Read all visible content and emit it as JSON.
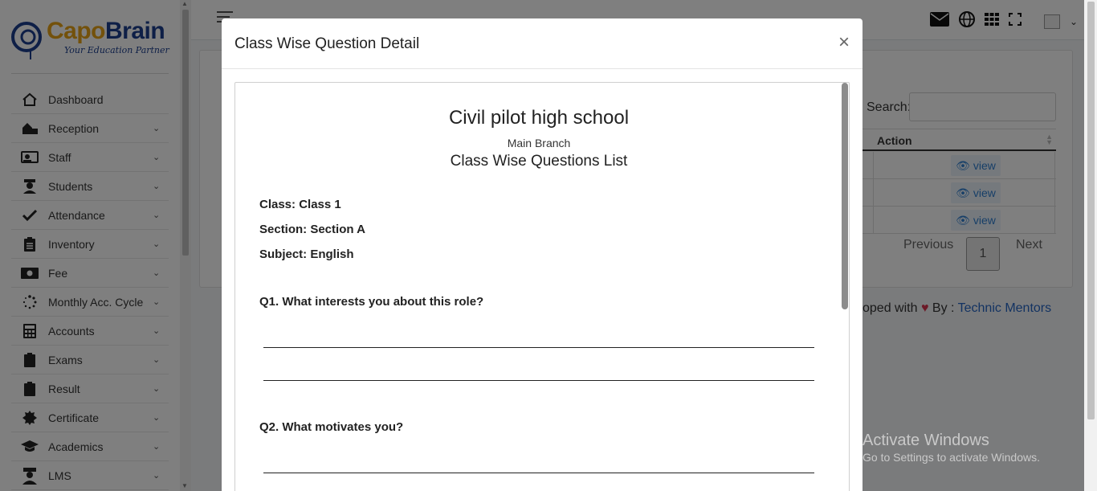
{
  "brand": {
    "part1": "Capo",
    "part2": "Brain",
    "tagline": "Your Education Partner"
  },
  "sidebar": {
    "items": [
      {
        "label": "Dashboard",
        "icon": "home-icon",
        "has_children": false
      },
      {
        "label": "Reception",
        "icon": "reception-icon",
        "has_children": true
      },
      {
        "label": "Staff",
        "icon": "staff-icon",
        "has_children": true
      },
      {
        "label": "Students",
        "icon": "student-icon",
        "has_children": true
      },
      {
        "label": "Attendance",
        "icon": "check-icon",
        "has_children": true
      },
      {
        "label": "Inventory",
        "icon": "clipboard-list-icon",
        "has_children": true
      },
      {
        "label": "Fee",
        "icon": "money-icon",
        "has_children": true
      },
      {
        "label": "Monthly Acc. Cycle",
        "icon": "spinner-icon",
        "has_children": true
      },
      {
        "label": "Accounts",
        "icon": "calculator-icon",
        "has_children": true
      },
      {
        "label": "Exams",
        "icon": "clipboard-icon",
        "has_children": true
      },
      {
        "label": "Result",
        "icon": "clipboard-icon",
        "has_children": true
      },
      {
        "label": "Certificate",
        "icon": "certificate-icon",
        "has_children": true
      },
      {
        "label": "Academics",
        "icon": "graduation-cap-icon",
        "has_children": true
      },
      {
        "label": "LMS",
        "icon": "teacher-icon",
        "has_children": true
      }
    ]
  },
  "topbar": {
    "icons": [
      "envelope-icon",
      "globe-icon",
      "grid-icon",
      "fullscreen-icon",
      "avatar"
    ]
  },
  "table": {
    "search_label": "Search:",
    "action_header": "Action",
    "rows": [
      {
        "action_label": "view"
      },
      {
        "action_label": "view"
      },
      {
        "action_label": "view"
      }
    ],
    "pagination": {
      "previous": "Previous",
      "current": "1",
      "next": "Next"
    }
  },
  "footer": {
    "prefix": "oped with",
    "by": "By :",
    "link": "Technic Mentors"
  },
  "watermark": {
    "line1": "Activate Windows",
    "line2": "Go to Settings to activate Windows."
  },
  "modal": {
    "title": "Class Wise Question Detail",
    "close": "×",
    "school_name": "Civil pilot high school",
    "branch": "Main Branch",
    "list_title": "Class Wise Questions List",
    "class_line": "Class: Class 1",
    "section_line": "Section: Section A",
    "subject_line": "Subject: English",
    "questions": [
      {
        "text": "Q1. What interests you about this role?"
      },
      {
        "text": "Q2. What motivates you?"
      }
    ]
  },
  "colors": {
    "brand_orange": "#e6a316",
    "brand_blue": "#1d3f8f",
    "link_blue": "#2766c4",
    "heart": "#d9354f"
  }
}
